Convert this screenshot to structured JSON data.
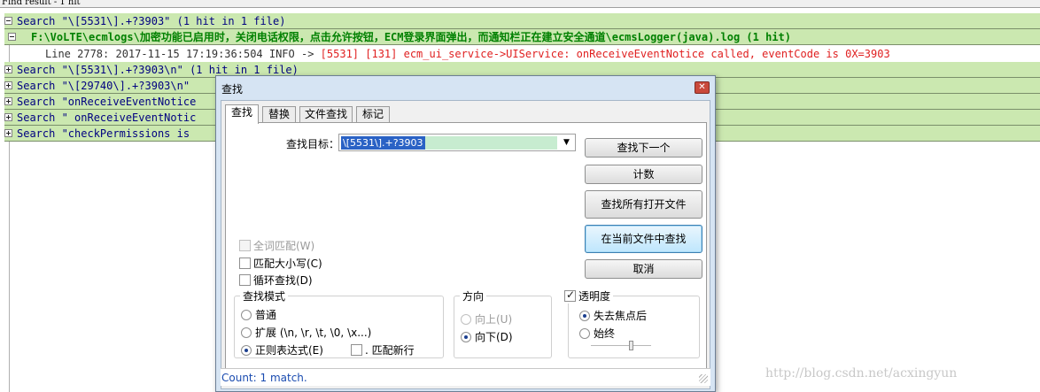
{
  "panel_title": "Find result - 1 hit",
  "results": {
    "rows": [
      {
        "type": "search",
        "text": "Search \"\\[5531\\].+?3903\" (1 hit in 1 file)"
      },
      {
        "type": "file",
        "text": "F:\\VoLTE\\ecmlogs\\加密功能已启用时，关闭电话权限，点击允许按钮，ECM登录界面弹出，而通知栏正在建立安全通道\\ecmsLogger(java).log (1 hit)"
      },
      {
        "type": "line",
        "prefix": "Line 2778: 2017-11-15 17:19:36:504  INFO -> ",
        "highlight": "[5531]  [131]  ecm_ui_service->UIService: onReceiveEventNotice called, eventCode is 0X=3903"
      },
      {
        "type": "search",
        "text": "Search \"\\[5531\\].+?3903\\n\" (1 hit in 1 file)"
      },
      {
        "type": "search",
        "text": "Search \"\\[29740\\].+?3903\\n\""
      },
      {
        "type": "search",
        "text": "Search \"onReceiveEventNotice"
      },
      {
        "type": "search",
        "text": "Search \" onReceiveEventNotic"
      },
      {
        "type": "search",
        "text": "Search \"checkPermissions is"
      }
    ]
  },
  "watermark": "http://blog.csdn.net/acxingyun",
  "dialog": {
    "title": "查找",
    "close_icon": "close-x",
    "tabs": [
      "查找",
      "替换",
      "文件查找",
      "标记"
    ],
    "active_tab": 0,
    "find_label": "查找目标：",
    "find_value": "\\[5531\\].+?3903",
    "buttons": {
      "find_next": "查找下一个",
      "count": "计数",
      "find_all_open": "查找所有打开文件",
      "find_in_current": "在当前文件中查找",
      "cancel": "取消"
    },
    "options": {
      "whole_word": {
        "label": "全词匹配(W)",
        "checked": false,
        "disabled": true
      },
      "match_case": {
        "label": "匹配大小写(C)",
        "checked": false
      },
      "wrap": {
        "label": "循环查找(D)",
        "checked": false
      }
    },
    "search_mode": {
      "legend": "查找模式",
      "normal": "普通",
      "extended": "扩展 (\\n, \\r, \\t, \\0, \\x...)",
      "regex": "正则表达式(E)",
      "dot_newline": ". 匹配新行",
      "selected": "regex"
    },
    "direction": {
      "legend": "方向",
      "up": "向上(U)",
      "down": "向下(D)",
      "selected": "down"
    },
    "transparency": {
      "legend": "透明度",
      "checked": true,
      "on_lose_focus": "失去焦点后",
      "always": "始终",
      "selected": "on_lose_focus",
      "slider_value": 0.68
    },
    "status": "Count: 1 match."
  }
}
